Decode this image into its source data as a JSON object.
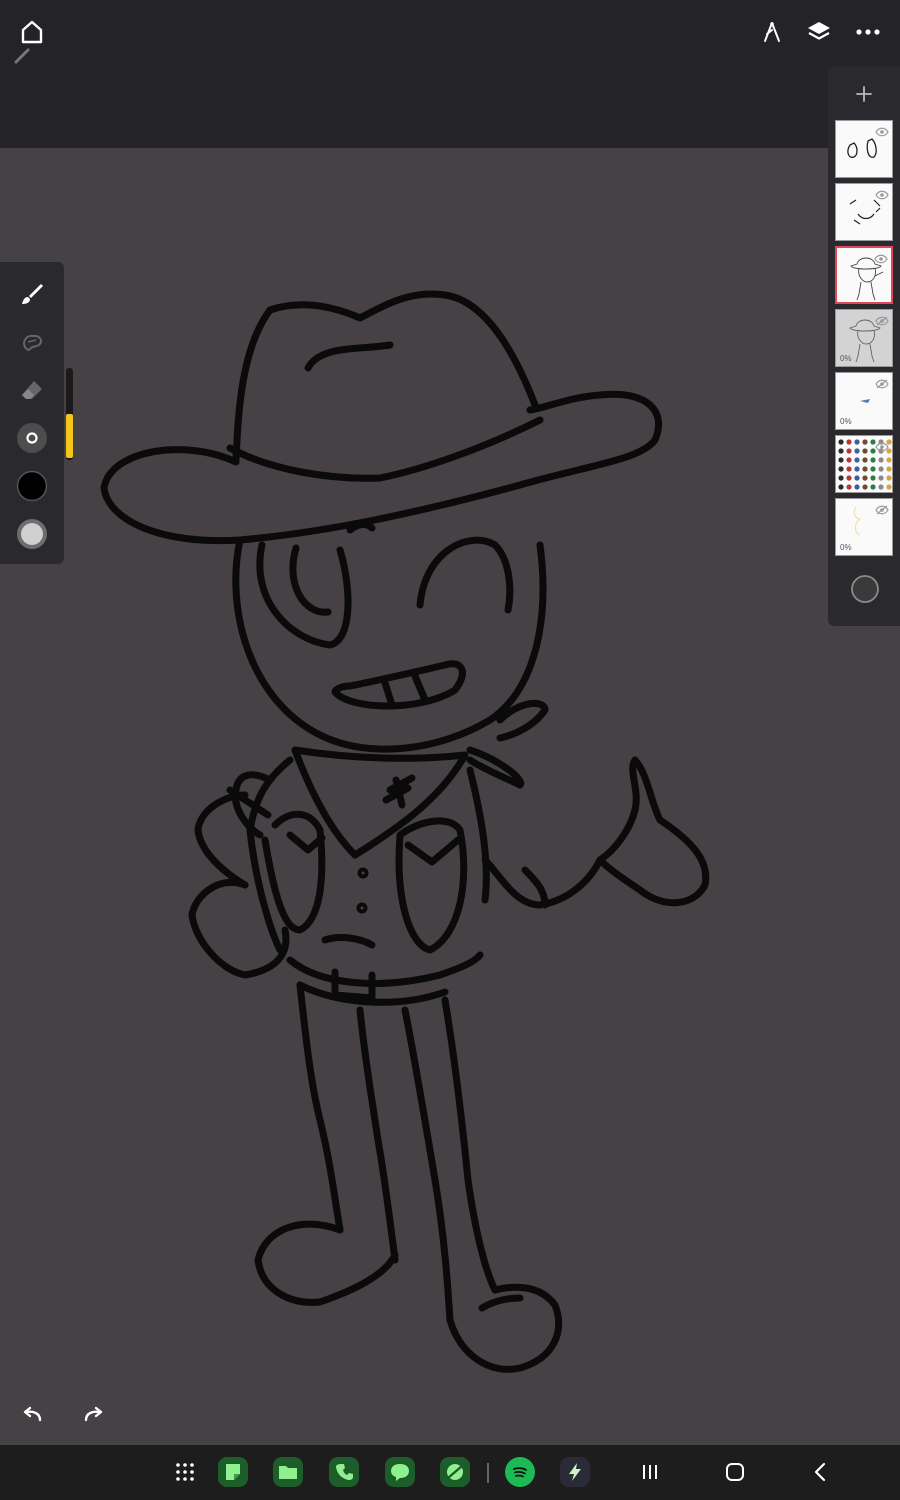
{
  "toolbar": {
    "home_icon": "home-icon",
    "ruler_icon": "ruler-icon",
    "layers_icon": "layers-icon",
    "more_icon": "more-icon"
  },
  "tools": {
    "items": [
      "brush-icon",
      "smudge-icon",
      "eraser-icon",
      "brush-size-icon",
      "primary-color-swatch",
      "secondary-color-swatch"
    ],
    "primary_color": "#000000",
    "secondary_color": "#cfcfcf",
    "brush_opacity_fraction": 0.5
  },
  "layers": {
    "add_icon": "plus-icon",
    "items": [
      {
        "thumb": "shoes-sketch",
        "visible": true,
        "selected": false,
        "opacity_label": ""
      },
      {
        "thumb": "face-sketch",
        "visible": true,
        "selected": false,
        "opacity_label": ""
      },
      {
        "thumb": "character-lineart",
        "visible": true,
        "selected": true,
        "opacity_label": ""
      },
      {
        "thumb": "character-sketch",
        "visible": false,
        "selected": false,
        "opacity_label": "0%"
      },
      {
        "thumb": "small-mark",
        "visible": false,
        "selected": false,
        "opacity_label": "0%"
      },
      {
        "thumb": "reference-sheet",
        "visible": true,
        "selected": false,
        "opacity_label": ""
      },
      {
        "thumb": "faint-sketch",
        "visible": false,
        "selected": false,
        "opacity_label": "0%"
      }
    ],
    "layer_color_icon": "circle-icon"
  },
  "history": {
    "undo_icon": "undo-icon",
    "redo_icon": "redo-icon"
  },
  "navbar": {
    "apps": [
      "apps-grid-icon",
      "notes-app-icon",
      "files-app-icon",
      "phone-app-icon",
      "messages-app-icon",
      "browser-app-icon",
      "spotify-app-icon",
      "bolt-app-icon"
    ],
    "recent_icon": "recent-apps-icon",
    "home_icon": "nav-home-icon",
    "back_icon": "back-icon"
  }
}
